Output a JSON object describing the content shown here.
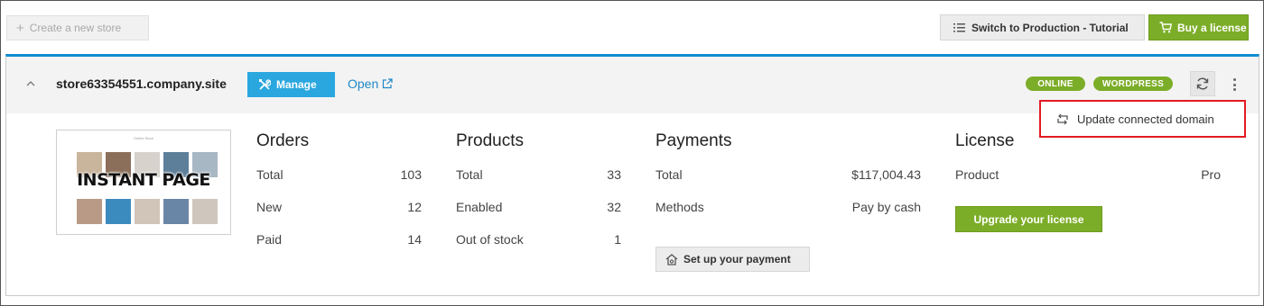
{
  "toolbar": {
    "create_store_label": "Create a new store",
    "tutorial_label": "Switch to Production - Tutorial",
    "buy_license_label": "Buy a license"
  },
  "store": {
    "name": "store63354551.company.site",
    "manage_label": "Manage",
    "open_label": "Open",
    "badges": [
      "ONLINE",
      "WORDPRESS"
    ],
    "menu": {
      "update_domain_label": "Update connected domain"
    },
    "thumbnail": {
      "title": "Online Store",
      "overlay_text": "INSTANT PAGE"
    },
    "orders": {
      "title": "Orders",
      "rows": [
        {
          "label": "Total",
          "value": "103"
        },
        {
          "label": "New",
          "value": "12"
        },
        {
          "label": "Paid",
          "value": "14"
        }
      ]
    },
    "products": {
      "title": "Products",
      "rows": [
        {
          "label": "Total",
          "value": "33"
        },
        {
          "label": "Enabled",
          "value": "32"
        },
        {
          "label": "Out of stock",
          "value": "1"
        }
      ]
    },
    "payments": {
      "title": "Payments",
      "rows": [
        {
          "label": "Total",
          "value": "$117,004.43"
        },
        {
          "label": "Methods",
          "value": "Pay by cash"
        }
      ],
      "setup_label": "Set up your payment"
    },
    "license": {
      "title": "License",
      "rows": [
        {
          "label": "Product",
          "value": "Pro"
        }
      ],
      "upgrade_label": "Upgrade your license"
    }
  },
  "colors": {
    "accent_blue": "#2aa7df",
    "green": "#7cad28",
    "highlight_red": "#e21b23"
  }
}
